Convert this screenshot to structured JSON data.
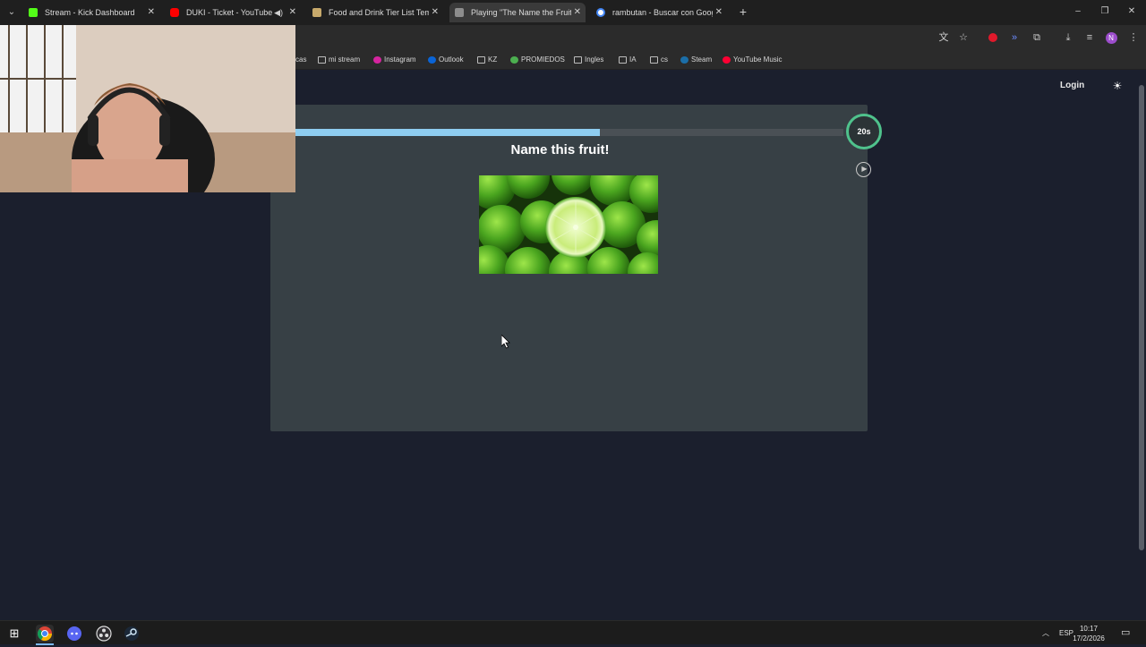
{
  "browser": {
    "tabs": [
      {
        "title": "Stream - Kick Dashboard",
        "favicon": "kick-icon",
        "color": "#53fc18",
        "active": false
      },
      {
        "title": "DUKI - Ticket - YouTube",
        "favicon": "youtube-icon",
        "color": "#ff0000",
        "active": false,
        "audio": true
      },
      {
        "title": "Food and Drink Tier List Templa",
        "favicon": "tierlist-icon",
        "color": "#c7a96b",
        "active": false
      },
      {
        "title": "Playing \"The Name the Fruit! Tr",
        "favicon": "quiz-icon",
        "color": "#8d8d8d",
        "active": true
      },
      {
        "title": "rambutan - Buscar con Google",
        "favicon": "google-icon",
        "color": "#4285f4",
        "active": false
      }
    ],
    "new_tab": "+",
    "window_controls": [
      "–",
      "❐",
      "✕"
    ],
    "profile_initial": "N"
  },
  "bookmarks": [
    {
      "label": "cas",
      "icon": "none"
    },
    {
      "label": "mi stream",
      "icon": "folder-icon"
    },
    {
      "label": "Instagram",
      "icon": "instagram-icon"
    },
    {
      "label": "Outlook",
      "icon": "outlook-icon"
    },
    {
      "label": "KZ",
      "icon": "folder-icon"
    },
    {
      "label": "PROMIEDOS",
      "icon": "promiedos-icon"
    },
    {
      "label": "Ingles",
      "icon": "folder-icon"
    },
    {
      "label": "IA",
      "icon": "folder-icon"
    },
    {
      "label": "cs",
      "icon": "folder-icon"
    },
    {
      "label": "Steam",
      "icon": "steam-icon"
    },
    {
      "label": "YouTube Music",
      "icon": "youtube-music-icon"
    }
  ],
  "site": {
    "login_label": "Login",
    "theme_icon": "sun-icon"
  },
  "quiz": {
    "question": "Name this fruit!",
    "timer_label": "20s",
    "progress_fraction": 0.575,
    "image_subject": "limes",
    "colors": {
      "progress": "#8ecdf0",
      "timer_ring": "#4fc28c",
      "card": "#374045"
    }
  },
  "taskbar": {
    "apps": [
      "windows-start-icon",
      "chrome-icon",
      "discord-icon",
      "obs-icon",
      "steam-icon"
    ],
    "language": "ESP",
    "time": "10:17",
    "date": "17/2/2026"
  }
}
